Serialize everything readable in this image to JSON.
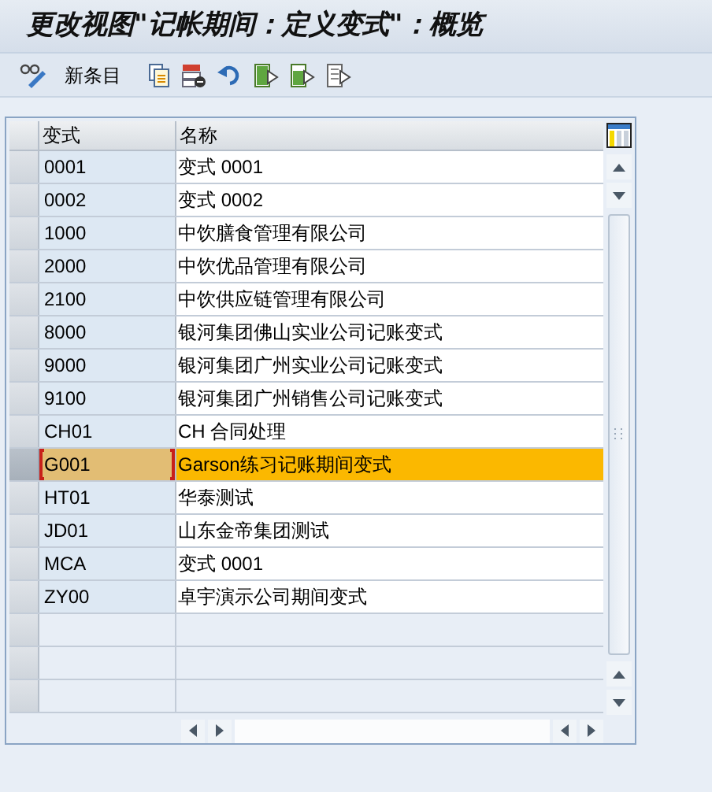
{
  "window": {
    "title": "更改视图\"记帐期间：定义变式\"：概览"
  },
  "toolbar": {
    "new_entry_label": "新条目"
  },
  "table": {
    "columns": [
      "变式",
      "名称"
    ],
    "rows": [
      {
        "key": "0001",
        "name": "变式 0001",
        "selected": false
      },
      {
        "key": "0002",
        "name": "变式 0002",
        "selected": false
      },
      {
        "key": "1000",
        "name": "中饮膳食管理有限公司",
        "selected": false
      },
      {
        "key": "2000",
        "name": "中饮优品管理有限公司",
        "selected": false
      },
      {
        "key": "2100",
        "name": "中饮供应链管理有限公司",
        "selected": false
      },
      {
        "key": "8000",
        "name": "银河集团佛山实业公司记账变式",
        "selected": false
      },
      {
        "key": "9000",
        "name": "银河集团广州实业公司记账变式",
        "selected": false
      },
      {
        "key": "9100",
        "name": "银河集团广州销售公司记账变式",
        "selected": false
      },
      {
        "key": "CH01",
        "name": "CH 合同处理",
        "selected": false
      },
      {
        "key": "G001",
        "name": "Garson练习记账期间变式",
        "selected": true
      },
      {
        "key": "HT01",
        "name": "华泰测试",
        "selected": false
      },
      {
        "key": "JD01",
        "name": "山东金帝集团测试",
        "selected": false
      },
      {
        "key": "MCA",
        "name": "变式 0001",
        "selected": false
      },
      {
        "key": "ZY00",
        "name": "卓宇演示公司期间变式",
        "selected": false
      }
    ]
  }
}
